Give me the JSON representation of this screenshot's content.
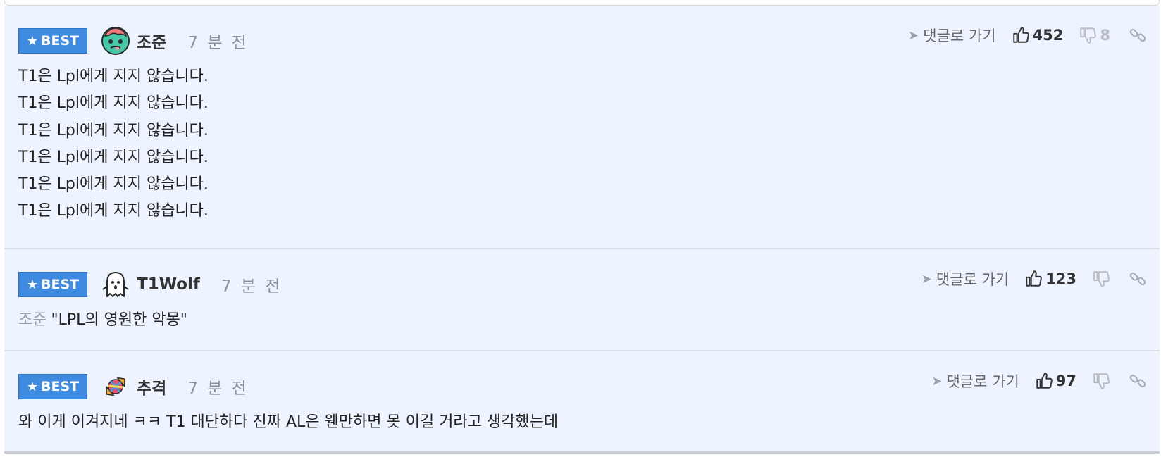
{
  "comments": [
    {
      "badge": "BEST",
      "nickname": "조준",
      "time": "7 분 전",
      "avatar_icon": "zombie-avatar-icon",
      "goto_label": "댓글로 가기",
      "likes": "452",
      "dislikes": "8",
      "lines": [
        "T1은 Lpl에게 지지 않습니다.",
        "T1은 Lpl에게 지지 않습니다.",
        "T1은 Lpl에게 지지 않습니다.",
        "T1은 Lpl에게 지지 않습니다.",
        "T1은 Lpl에게 지지 않습니다.",
        "T1은 Lpl에게 지지 않습니다."
      ]
    },
    {
      "badge": "BEST",
      "nickname": "T1Wolf",
      "time": "7 분 전",
      "avatar_icon": "ghost-avatar-icon",
      "goto_label": "댓글로 가기",
      "likes": "123",
      "mention": "조준",
      "text": "\"LPL의 영원한 악몽\""
    },
    {
      "badge": "BEST",
      "nickname": "추격",
      "time": "7 분 전",
      "avatar_icon": "candy-avatar-icon",
      "goto_label": "댓글로 가기",
      "likes": "97",
      "text": "와 이게 이겨지네 ㅋㅋ T1 대단하다 진짜 AL은 웬만하면 못 이길 거라고 생각했는데"
    }
  ],
  "colors": {
    "comment_bg": "#eef4ff",
    "badge_bg": "#3f8be0",
    "muted": "#8a8f96"
  }
}
